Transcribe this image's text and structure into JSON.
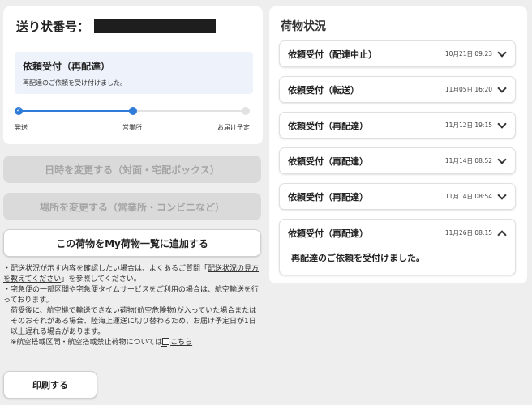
{
  "tracking": {
    "label": "送り状番号：",
    "status_title": "依頼受付（再配達）",
    "status_desc": "再配達のご依頼を受け付けました。",
    "steps": [
      "発送",
      "営業所",
      "お届け予定"
    ],
    "progress_fraction": 0.5
  },
  "buttons": {
    "change_date": "日時を変更する（対面・宅配ボックス）",
    "change_place": "場所を変更する（営業所・コンビニなど）",
    "add_to_list": "この荷物をMy荷物一覧に追加する",
    "print": "印刷する"
  },
  "notes": {
    "line1_pre": "・配送状況が示す内容を確認したい場合は、よくあるご質問「",
    "line1_link": "配送状況の見方を教えてください",
    "line1_post": "」を参照してください。",
    "line2": "・宅急便の一部区間や宅急便タイムサービスをご利用の場合は、航空輸送を行っております。",
    "line3": "荷受後に、航空機で輸送できない荷物(航空危険物)が入っていた場合またはそのおそれがある場合、陸海上運送に切り替わるため、お届け予定日が1日以上遅れる場合があります。",
    "line4_pre": "※航空搭載区間・航空搭載禁止荷物については",
    "line4_link": "こちら"
  },
  "history": {
    "title": "荷物状況",
    "items": [
      {
        "status": "依頼受付（配達中止）",
        "time": "10月21日 09:23"
      },
      {
        "status": "依頼受付（転送）",
        "time": "11月05日 16:20"
      },
      {
        "status": "依頼受付（再配達）",
        "time": "11月12日 19:15"
      },
      {
        "status": "依頼受付（再配達）",
        "time": "11月14日 08:52"
      },
      {
        "status": "依頼受付（再配達）",
        "time": "11月14日 08:54"
      },
      {
        "status": "依頼受付（再配達）",
        "time": "11月26日 08:15",
        "detail": "再配達のご依頼を受付けました。"
      }
    ]
  }
}
